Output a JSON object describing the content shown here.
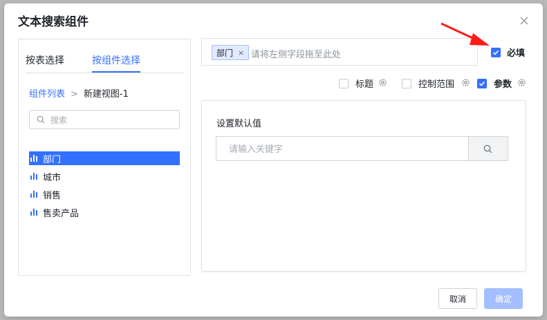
{
  "dialog": {
    "title": "文本搜索组件",
    "close_icon": "close-icon"
  },
  "left": {
    "tabs": [
      {
        "label": "按表选择",
        "active": false
      },
      {
        "label": "按组件选择",
        "active": true
      }
    ],
    "breadcrumb": {
      "root": "组件列表",
      "current": "新建视图-1"
    },
    "search": {
      "placeholder": "搜索",
      "value": ""
    },
    "fields": [
      {
        "label": "部门",
        "selected": true,
        "icon": "bar-chart-icon"
      },
      {
        "label": "城市",
        "selected": false,
        "icon": "bar-chart-icon"
      },
      {
        "label": "销售",
        "selected": false,
        "icon": "bar-chart-icon"
      },
      {
        "label": "售卖产品",
        "selected": false,
        "icon": "bar-chart-icon"
      }
    ]
  },
  "dropzone": {
    "tag": "部门",
    "tag_remove": "×",
    "hint": "请将左侧字段拖至此处"
  },
  "options": {
    "required": {
      "label": "必填",
      "checked": true
    },
    "title": {
      "label": "标题",
      "checked": false
    },
    "range": {
      "label": "控制范围",
      "checked": false
    },
    "param": {
      "label": "参数",
      "checked": true
    }
  },
  "default_value": {
    "label": "设置默认值",
    "placeholder": "请输入关键字",
    "value": ""
  },
  "footer": {
    "cancel": "取消",
    "confirm": "确定"
  },
  "colors": {
    "accent": "#3370ff",
    "accent_disabled": "#a3bfff",
    "annotation_arrow": "#ff1a1a"
  }
}
